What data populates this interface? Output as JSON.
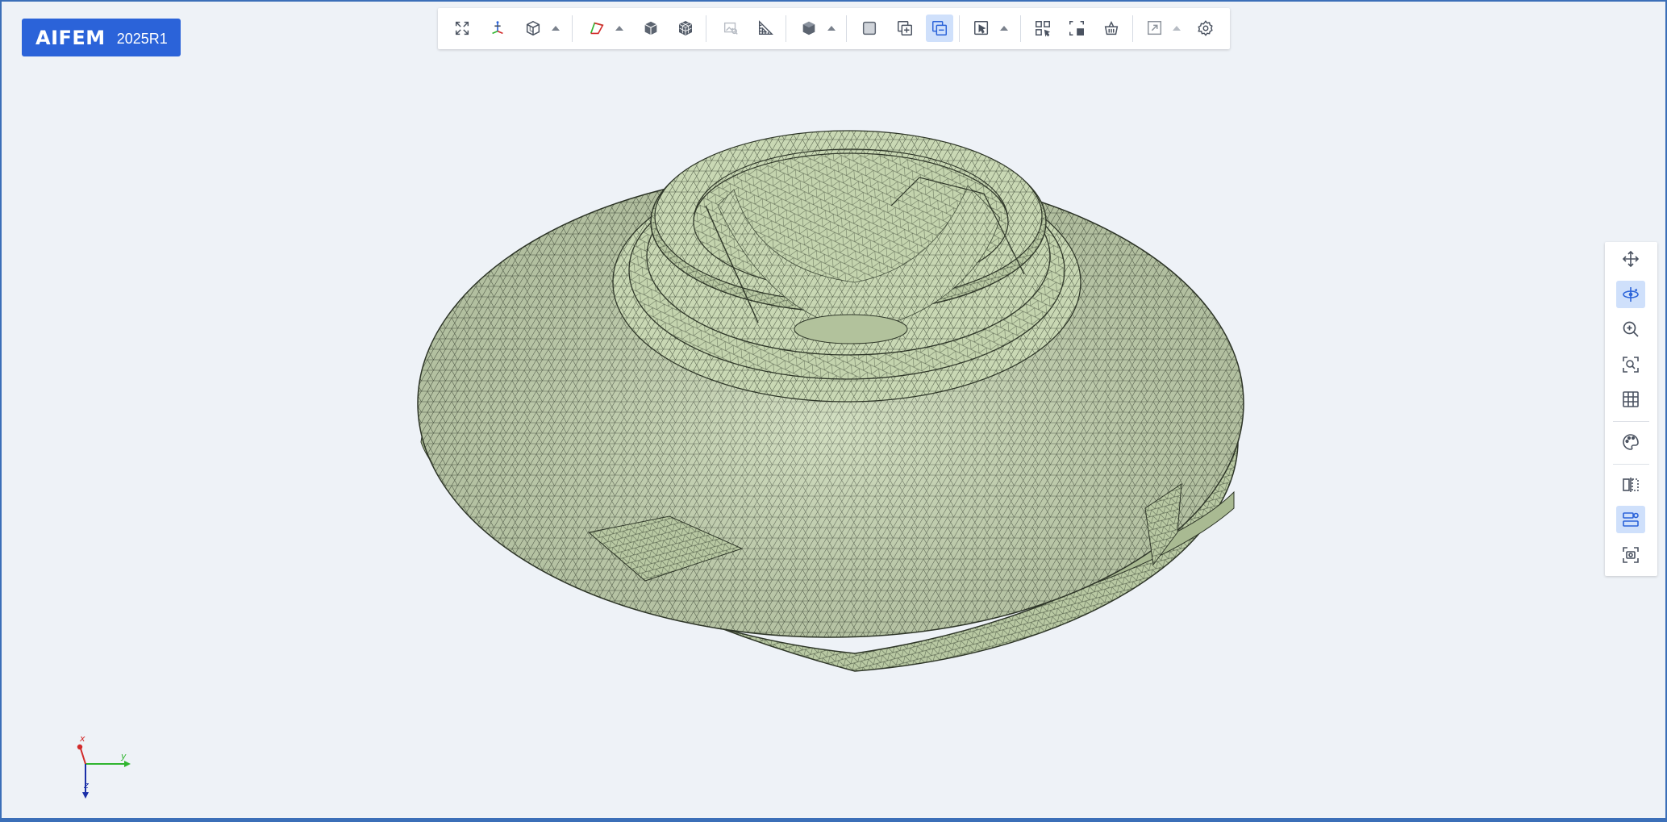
{
  "app": {
    "name": "AIFEM",
    "version": "2025R1"
  },
  "toolbar": {
    "items": [
      {
        "icon": "fit-view-icon"
      },
      {
        "icon": "coordinate-axes-icon"
      },
      {
        "icon": "view-cube-icon",
        "dropdown": true
      },
      {
        "icon": "geometry-display-icon",
        "dropdown": true
      },
      {
        "icon": "solid-cube-icon"
      },
      {
        "icon": "mesh-cube-icon"
      },
      {
        "icon": "image-view-icon",
        "disabled": true
      },
      {
        "icon": "measure-ruler-icon"
      },
      {
        "icon": "shading-mode-icon",
        "dropdown": true
      },
      {
        "icon": "single-box-icon"
      },
      {
        "icon": "add-copy-icon"
      },
      {
        "icon": "remove-copy-icon",
        "active": true
      },
      {
        "icon": "pointer-select-icon",
        "dropdown": true
      },
      {
        "icon": "box-select-icon"
      },
      {
        "icon": "select-fill-icon"
      },
      {
        "icon": "basket-icon"
      },
      {
        "icon": "export-arrow-icon",
        "dropdown": true,
        "disabled": true
      },
      {
        "icon": "settings-gear-icon"
      }
    ]
  },
  "sidebar": {
    "items": [
      {
        "icon": "pan-move-icon"
      },
      {
        "icon": "rotate-view-icon",
        "active": true
      },
      {
        "icon": "zoom-in-icon"
      },
      {
        "icon": "zoom-fit-icon"
      },
      {
        "icon": "grid-icon"
      },
      {
        "icon": "color-palette-icon"
      },
      {
        "icon": "section-plane-icon"
      },
      {
        "icon": "display-toggle-icon",
        "active": true
      },
      {
        "icon": "screenshot-icon"
      }
    ]
  },
  "triad": {
    "x_label": "x",
    "y_label": "y",
    "z_label": "z"
  },
  "colors": {
    "accent": "#2b63d9",
    "mesh_fill": "#c9d8b4",
    "mesh_line": "#3c4735",
    "background": "#eef2f7",
    "axis_x": "#d22b2b",
    "axis_y": "#2fb52f",
    "axis_z": "#1a2fa8"
  }
}
